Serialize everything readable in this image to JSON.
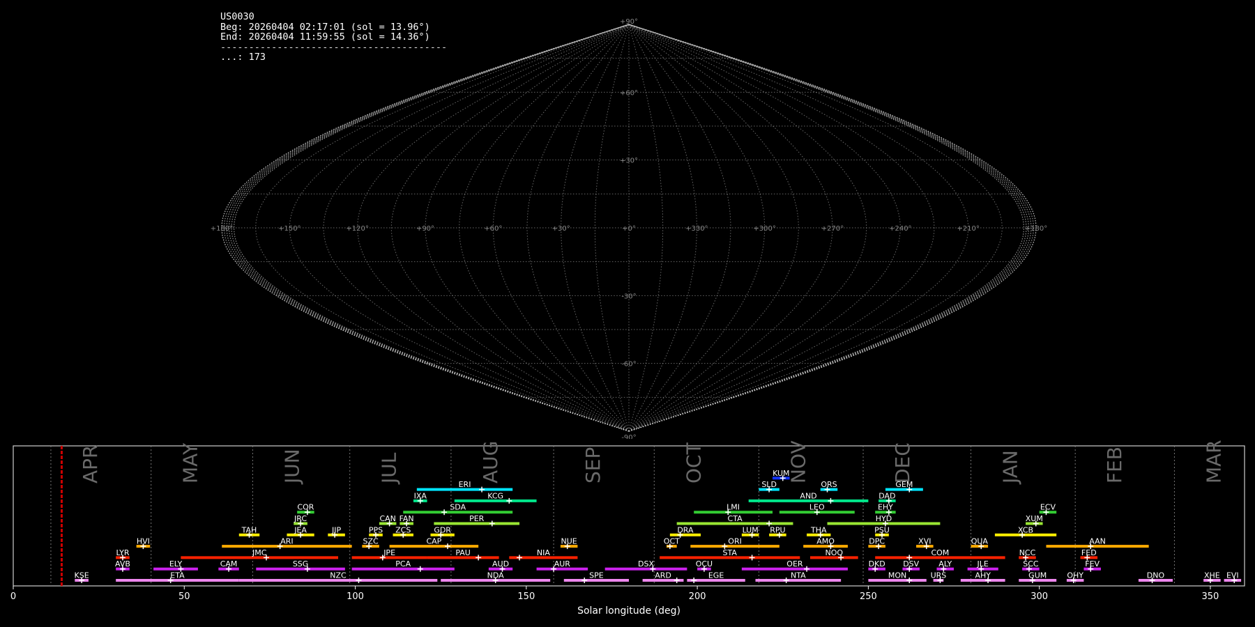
{
  "header": {
    "station": "US0030",
    "begin": "Beg: 20260404 02:17:01 (sol = 13.96°)",
    "end": "End: 20260404 11:59:55 (sol = 14.36°)",
    "separator": "----------------------------------------",
    "count": "...: 173"
  },
  "sky_map": {
    "projection": "sinusoidal",
    "lon_labels": [
      "+180°",
      "+150°",
      "+120°",
      "+90°",
      "+60°",
      "+30°",
      "+0°",
      "+330°",
      "+300°",
      "+270°",
      "+240°",
      "+210°",
      "+180°"
    ],
    "lat_labels": [
      "+90°",
      "+60°",
      "+30°",
      "-30°",
      "-60°",
      "-90°"
    ],
    "colors": {
      "grid": "#bbbbbb",
      "track": "#aaaaaa"
    }
  },
  "chart_data": {
    "type": "timeline",
    "xlabel": "Solar longitude (deg)",
    "xlim": [
      0,
      360
    ],
    "xticks": [
      0,
      50,
      100,
      150,
      200,
      250,
      300,
      350
    ],
    "current_sol": 14.16,
    "current_color": "#cc0000",
    "months": [
      {
        "name": "APR",
        "start": 11.0
      },
      {
        "name": "MAY",
        "start": 40.3
      },
      {
        "name": "JUN",
        "start": 70.0
      },
      {
        "name": "JUL",
        "start": 98.4
      },
      {
        "name": "AUG",
        "start": 128.0
      },
      {
        "name": "SEP",
        "start": 158.0
      },
      {
        "name": "OCT",
        "start": 187.4
      },
      {
        "name": "NOV",
        "start": 218.0
      },
      {
        "name": "DEC",
        "start": 248.5
      },
      {
        "name": "JAN",
        "start": 280.0
      },
      {
        "name": "FEB",
        "start": 310.5
      },
      {
        "name": "MAR",
        "start": 339.5
      }
    ],
    "showers": [
      {
        "name": "KUM",
        "start": 222,
        "end": 227,
        "peak": 225,
        "row": 9,
        "color": "#1133ff"
      },
      {
        "name": "ERI",
        "start": 118,
        "end": 146,
        "peak": 137,
        "row": 8,
        "color": "#00e5ff"
      },
      {
        "name": "SLD",
        "start": 218,
        "end": 224,
        "peak": 221,
        "row": 8,
        "color": "#00e5ff"
      },
      {
        "name": "ORS",
        "start": 236,
        "end": 241,
        "peak": 238,
        "row": 8,
        "color": "#00e5ff"
      },
      {
        "name": "GEM",
        "start": 255,
        "end": 266,
        "peak": 262,
        "row": 8,
        "color": "#00e5ff"
      },
      {
        "name": "IXA",
        "start": 117,
        "end": 121,
        "peak": 119,
        "row": 7,
        "color": "#00e68a"
      },
      {
        "name": "KCG",
        "start": 129,
        "end": 153,
        "peak": 145,
        "row": 7,
        "color": "#00e68a"
      },
      {
        "name": "AND",
        "start": 215,
        "end": 250,
        "peak": 239,
        "row": 7,
        "color": "#00e68a"
      },
      {
        "name": "DAD",
        "start": 253,
        "end": 258,
        "peak": 256,
        "row": 7,
        "color": "#00e68a"
      },
      {
        "name": "COR",
        "start": 83,
        "end": 88,
        "peak": 86,
        "row": 6,
        "color": "#33cc33"
      },
      {
        "name": "SDA",
        "start": 114,
        "end": 146,
        "peak": 126,
        "row": 6,
        "color": "#33cc33"
      },
      {
        "name": "LMI",
        "start": 199,
        "end": 222,
        "peak": 209,
        "row": 6,
        "color": "#33cc33"
      },
      {
        "name": "LEO",
        "start": 224,
        "end": 246,
        "peak": 235,
        "row": 6,
        "color": "#33cc33"
      },
      {
        "name": "EHY",
        "start": 252,
        "end": 258,
        "peak": 256,
        "row": 6,
        "color": "#33cc33"
      },
      {
        "name": "ECV",
        "start": 300,
        "end": 305,
        "peak": 302,
        "row": 6,
        "color": "#33cc33"
      },
      {
        "name": "JRC",
        "start": 82,
        "end": 86,
        "peak": 84,
        "row": 5,
        "color": "#99e633"
      },
      {
        "name": "CAN",
        "start": 107,
        "end": 112,
        "peak": 110,
        "row": 5,
        "color": "#99e633"
      },
      {
        "name": "FAN",
        "start": 113,
        "end": 117,
        "peak": 115,
        "row": 5,
        "color": "#99e633"
      },
      {
        "name": "PER",
        "start": 123,
        "end": 148,
        "peak": 140,
        "row": 5,
        "color": "#99e633"
      },
      {
        "name": "CTA",
        "start": 194,
        "end": 228,
        "peak": 221,
        "row": 5,
        "color": "#99e633"
      },
      {
        "name": "HYD",
        "start": 238,
        "end": 271,
        "peak": 255,
        "row": 5,
        "color": "#99e633"
      },
      {
        "name": "XUM",
        "start": 296,
        "end": 301,
        "peak": 299,
        "row": 5,
        "color": "#99e633"
      },
      {
        "name": "TAH",
        "start": 66,
        "end": 72,
        "peak": 69,
        "row": 4,
        "color": "#ffee00"
      },
      {
        "name": "JEA",
        "start": 80,
        "end": 88,
        "peak": 84,
        "row": 4,
        "color": "#ffee00"
      },
      {
        "name": "JIP",
        "start": 92,
        "end": 97,
        "peak": 94,
        "row": 4,
        "color": "#ffee00"
      },
      {
        "name": "PPS",
        "start": 104,
        "end": 108,
        "peak": 106,
        "row": 4,
        "color": "#ffee00"
      },
      {
        "name": "ZCS",
        "start": 111,
        "end": 117,
        "peak": 114,
        "row": 4,
        "color": "#ffee00"
      },
      {
        "name": "GDR",
        "start": 122,
        "end": 129,
        "peak": 125,
        "row": 4,
        "color": "#ffee00"
      },
      {
        "name": "DRA",
        "start": 192,
        "end": 201,
        "peak": 195,
        "row": 4,
        "color": "#ffee00"
      },
      {
        "name": "LUM",
        "start": 213,
        "end": 218,
        "peak": 216,
        "row": 4,
        "color": "#ffee00"
      },
      {
        "name": "RPU",
        "start": 221,
        "end": 226,
        "peak": 224,
        "row": 4,
        "color": "#ffee00"
      },
      {
        "name": "THA",
        "start": 232,
        "end": 239,
        "peak": 236,
        "row": 4,
        "color": "#ffee00"
      },
      {
        "name": "PSU",
        "start": 252,
        "end": 256,
        "peak": 254,
        "row": 4,
        "color": "#ffee00"
      },
      {
        "name": "XCB",
        "start": 287,
        "end": 305,
        "peak": 295,
        "row": 4,
        "color": "#ffee00"
      },
      {
        "name": "HVI",
        "start": 36,
        "end": 40,
        "peak": 38,
        "row": 3,
        "color": "#ffaa00"
      },
      {
        "name": "ARI",
        "start": 61,
        "end": 99,
        "peak": 78,
        "row": 3,
        "color": "#ffaa00"
      },
      {
        "name": "SZC",
        "start": 102,
        "end": 107,
        "peak": 104,
        "row": 3,
        "color": "#ffaa00"
      },
      {
        "name": "CAP",
        "start": 110,
        "end": 136,
        "peak": 127,
        "row": 3,
        "color": "#ffaa00"
      },
      {
        "name": "NUE",
        "start": 160,
        "end": 165,
        "peak": 162,
        "row": 3,
        "color": "#ffaa00"
      },
      {
        "name": "OCT",
        "start": 191,
        "end": 194,
        "peak": 192,
        "row": 3,
        "color": "#ffaa00"
      },
      {
        "name": "ORI",
        "start": 198,
        "end": 224,
        "peak": 208,
        "row": 3,
        "color": "#ffaa00"
      },
      {
        "name": "AMO",
        "start": 231,
        "end": 244,
        "peak": 239,
        "row": 3,
        "color": "#ffaa00"
      },
      {
        "name": "DPC",
        "start": 250,
        "end": 255,
        "peak": 253,
        "row": 3,
        "color": "#ffaa00"
      },
      {
        "name": "XVI",
        "start": 264,
        "end": 269,
        "peak": 267,
        "row": 3,
        "color": "#ffaa00"
      },
      {
        "name": "QUA",
        "start": 280,
        "end": 285,
        "peak": 283,
        "row": 3,
        "color": "#ffaa00"
      },
      {
        "name": "AAN",
        "start": 302,
        "end": 332,
        "peak": 315,
        "row": 3,
        "color": "#ffaa00"
      },
      {
        "name": "LYR",
        "start": 30,
        "end": 34,
        "peak": 32,
        "row": 2,
        "color": "#ff2200"
      },
      {
        "name": "JMC",
        "start": 49,
        "end": 95,
        "peak": 74,
        "row": 2,
        "color": "#ff2200"
      },
      {
        "name": "JPE",
        "start": 99,
        "end": 121,
        "peak": 108,
        "row": 2,
        "color": "#ff2200"
      },
      {
        "name": "PAU",
        "start": 121,
        "end": 142,
        "peak": 136,
        "row": 2,
        "color": "#ff2200"
      },
      {
        "name": "NIA",
        "start": 145,
        "end": 165,
        "peak": 148,
        "row": 2,
        "color": "#ff2200"
      },
      {
        "name": "STA",
        "start": 189,
        "end": 230,
        "peak": 216,
        "row": 2,
        "color": "#ff2200"
      },
      {
        "name": "NOO",
        "start": 233,
        "end": 247,
        "peak": 242,
        "row": 2,
        "color": "#ff2200"
      },
      {
        "name": "COM",
        "start": 252,
        "end": 290,
        "peak": 262,
        "row": 2,
        "color": "#ff2200"
      },
      {
        "name": "NCC",
        "start": 294,
        "end": 299,
        "peak": 296,
        "row": 2,
        "color": "#ff2200"
      },
      {
        "name": "FED",
        "start": 312,
        "end": 317,
        "peak": 314,
        "row": 2,
        "color": "#ff2200"
      },
      {
        "name": "AVB",
        "start": 30,
        "end": 34,
        "peak": 32,
        "row": 1,
        "color": "#cc22ee"
      },
      {
        "name": "ELY",
        "start": 41,
        "end": 54,
        "peak": 49,
        "row": 1,
        "color": "#cc22ee"
      },
      {
        "name": "CAM",
        "start": 60,
        "end": 66,
        "peak": 63,
        "row": 1,
        "color": "#cc22ee"
      },
      {
        "name": "SSG",
        "start": 71,
        "end": 97,
        "peak": 86,
        "row": 1,
        "color": "#cc22ee"
      },
      {
        "name": "PCA",
        "start": 99,
        "end": 129,
        "peak": 119,
        "row": 1,
        "color": "#cc22ee"
      },
      {
        "name": "AUD",
        "start": 139,
        "end": 146,
        "peak": 143,
        "row": 1,
        "color": "#cc22ee"
      },
      {
        "name": "AUR",
        "start": 153,
        "end": 168,
        "peak": 158,
        "row": 1,
        "color": "#cc22ee"
      },
      {
        "name": "DSX",
        "start": 173,
        "end": 197,
        "peak": 187,
        "row": 1,
        "color": "#cc22ee"
      },
      {
        "name": "OCU",
        "start": 200,
        "end": 204,
        "peak": 202,
        "row": 1,
        "color": "#cc22ee"
      },
      {
        "name": "OER",
        "start": 213,
        "end": 244,
        "peak": 232,
        "row": 1,
        "color": "#cc22ee"
      },
      {
        "name": "DKD",
        "start": 250,
        "end": 255,
        "peak": 252,
        "row": 1,
        "color": "#cc22ee"
      },
      {
        "name": "DSV",
        "start": 260,
        "end": 265,
        "peak": 262,
        "row": 1,
        "color": "#cc22ee"
      },
      {
        "name": "ALY",
        "start": 270,
        "end": 275,
        "peak": 272,
        "row": 1,
        "color": "#cc22ee"
      },
      {
        "name": "JLE",
        "start": 279,
        "end": 288,
        "peak": 283,
        "row": 1,
        "color": "#cc22ee"
      },
      {
        "name": "SCC",
        "start": 295,
        "end": 300,
        "peak": 297,
        "row": 1,
        "color": "#cc22ee"
      },
      {
        "name": "FEV",
        "start": 313,
        "end": 318,
        "peak": 315,
        "row": 1,
        "color": "#cc22ee"
      },
      {
        "name": "KSE",
        "start": 18,
        "end": 22,
        "peak": 20,
        "row": 0,
        "color": "#ee88ee"
      },
      {
        "name": "ETA",
        "start": 30,
        "end": 66,
        "peak": 46,
        "row": 0,
        "color": "#ee88ee"
      },
      {
        "name": "NZC",
        "start": 66,
        "end": 124,
        "peak": 101,
        "row": 0,
        "color": "#ee88ee"
      },
      {
        "name": "NDA",
        "start": 125,
        "end": 157,
        "peak": 141,
        "row": 0,
        "color": "#ee88ee"
      },
      {
        "name": "SPE",
        "start": 161,
        "end": 180,
        "peak": 167,
        "row": 0,
        "color": "#ee88ee"
      },
      {
        "name": "ARD",
        "start": 184,
        "end": 196,
        "peak": 194,
        "row": 0,
        "color": "#ee88ee"
      },
      {
        "name": "EGE",
        "start": 197,
        "end": 214,
        "peak": 199,
        "row": 0,
        "color": "#ee88ee"
      },
      {
        "name": "NTA",
        "start": 217,
        "end": 242,
        "peak": 226,
        "row": 0,
        "color": "#ee88ee"
      },
      {
        "name": "MON",
        "start": 250,
        "end": 267,
        "peak": 262,
        "row": 0,
        "color": "#ee88ee"
      },
      {
        "name": "URS",
        "start": 269,
        "end": 272,
        "peak": 271,
        "row": 0,
        "color": "#ee88ee"
      },
      {
        "name": "AHY",
        "start": 277,
        "end": 290,
        "peak": 285,
        "row": 0,
        "color": "#ee88ee"
      },
      {
        "name": "GUM",
        "start": 294,
        "end": 305,
        "peak": 298,
        "row": 0,
        "color": "#ee88ee"
      },
      {
        "name": "OHY",
        "start": 308,
        "end": 313,
        "peak": 310,
        "row": 0,
        "color": "#ee88ee"
      },
      {
        "name": "DNO",
        "start": 329,
        "end": 339,
        "peak": 333,
        "row": 0,
        "color": "#ee88ee"
      },
      {
        "name": "XHE",
        "start": 348,
        "end": 353,
        "peak": 350,
        "row": 0,
        "color": "#ee88ee"
      },
      {
        "name": "EVI",
        "start": 354,
        "end": 359,
        "peak": 357,
        "row": 0,
        "color": "#ee88ee"
      }
    ]
  }
}
